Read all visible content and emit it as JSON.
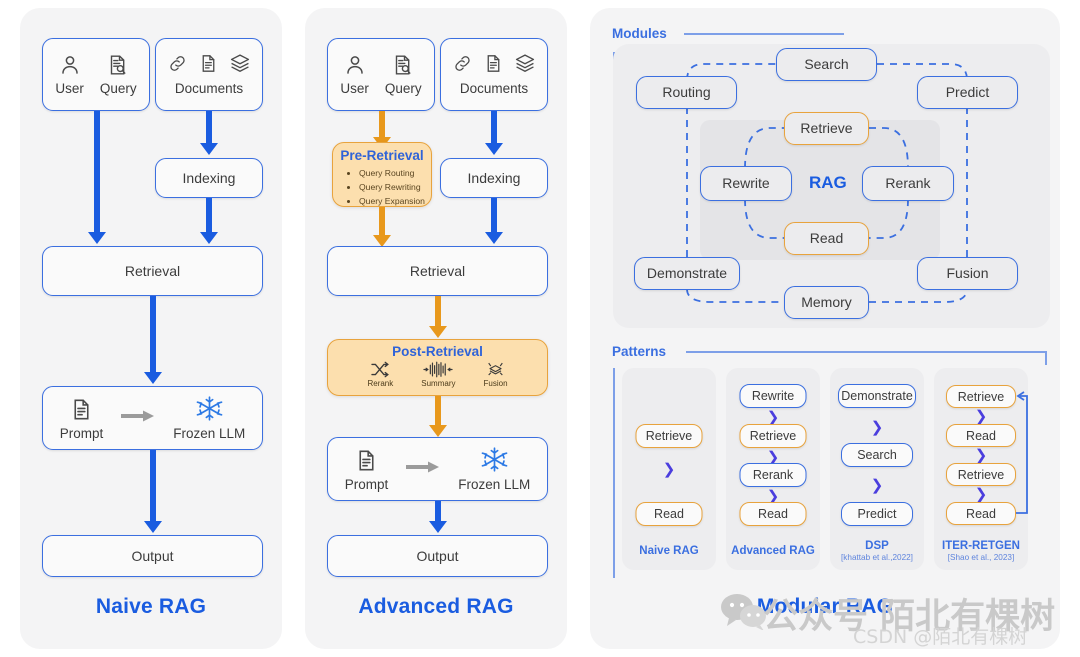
{
  "panels": {
    "naive": {
      "title": "Naive RAG",
      "input_user": "User",
      "input_query": "Query",
      "input_documents": "Documents",
      "indexing": "Indexing",
      "retrieval": "Retrieval",
      "prompt": "Prompt",
      "frozen_llm": "Frozen LLM",
      "output": "Output"
    },
    "advanced": {
      "title": "Advanced RAG",
      "input_user": "User",
      "input_query": "Query",
      "input_documents": "Documents",
      "indexing": "Indexing",
      "retrieval": "Retrieval",
      "pre_retrieval": {
        "title": "Pre-Retrieval",
        "items": [
          "Query Routing",
          "Query Rewriting",
          "Query Expansion"
        ]
      },
      "post_retrieval": {
        "title": "Post-Retrieval",
        "items": [
          "Rerank",
          "Summary",
          "Fusion"
        ]
      },
      "prompt": "Prompt",
      "frozen_llm": "Frozen LLM",
      "output": "Output"
    },
    "modular": {
      "title": "Modular RAG",
      "modules_label": "Modules",
      "patterns_label": "Patterns",
      "rag_label": "RAG",
      "modules": {
        "search": "Search",
        "routing": "Routing",
        "predict": "Predict",
        "retrieve": "Retrieve",
        "rewrite": "Rewrite",
        "rerank": "Rerank",
        "read": "Read",
        "demonstrate": "Demonstrate",
        "fusion": "Fusion",
        "memory": "Memory"
      },
      "patterns": [
        {
          "name": "Naive RAG",
          "citation": "",
          "steps": [
            {
              "label": "Retrieve",
              "color": "orange"
            },
            {
              "label": "Read",
              "color": "orange"
            }
          ]
        },
        {
          "name": "Advanced RAG",
          "citation": "",
          "steps": [
            {
              "label": "Rewrite",
              "color": "blue"
            },
            {
              "label": "Retrieve",
              "color": "orange"
            },
            {
              "label": "Rerank",
              "color": "blue"
            },
            {
              "label": "Read",
              "color": "orange"
            }
          ]
        },
        {
          "name": "DSP",
          "citation": "[khattab et al.,2022]",
          "steps": [
            {
              "label": "Demonstrate",
              "color": "blue"
            },
            {
              "label": "Search",
              "color": "blue"
            },
            {
              "label": "Predict",
              "color": "blue"
            }
          ]
        },
        {
          "name": "ITER-RETGEN",
          "citation": "[Shao et al., 2023]",
          "steps": [
            {
              "label": "Retrieve",
              "color": "orange"
            },
            {
              "label": "Read",
              "color": "orange"
            },
            {
              "label": "Retrieve",
              "color": "orange"
            },
            {
              "label": "Read",
              "color": "orange"
            }
          ]
        }
      ]
    }
  },
  "watermark": {
    "wechat": "公众号 陌北有棵树",
    "csdn": "CSDN @陌北有棵树"
  },
  "colors": {
    "blue": "#1a5ce0",
    "orange": "#e8981c",
    "border_blue": "#3b6fe0",
    "border_orange": "#e8a33d",
    "panel_bg": "#f4f4f5"
  }
}
